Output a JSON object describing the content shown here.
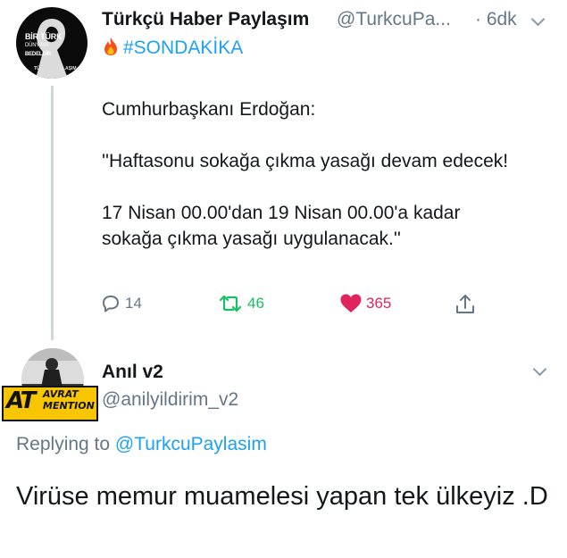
{
  "tweet1": {
    "avatar": {
      "line1": "BİR TÜRK",
      "line2": "DÜNYAYA",
      "line3": "BEDELDİR",
      "sub": "TÜRKÇÜ PAYLAŞIM"
    },
    "name": "Türkçü Haber Paylaşım",
    "handle": "@TurkcuPa...",
    "time": "· 6dk",
    "hashtag_icon": "fire-emoji",
    "hashtag": "#SONDAKİKA",
    "body": "Cumhurbaşkanı Erdoğan:\n\n''Haftasonu sokağa çıkma yasağı devam edecek!\n\n17 Nisan 00.00'dan 19 Nisan 00.00'a kadar sokağa çıkma yasağı uygulanacak.''",
    "actions": {
      "replies": "14",
      "retweets": "46",
      "likes": "365"
    }
  },
  "tweet2": {
    "avatar_badge": {
      "big": "AT",
      "top": "AVRAT",
      "bottom": "MENTION"
    },
    "name": "Anıl v2",
    "handle": "@anilyildirim_v2",
    "replying_prefix": "Replying to",
    "replying_mention": "@TurkcuPaylasim",
    "body": "Virüse memur muamelesi yapan tek ülkeyiz .D"
  },
  "colors": {
    "accent": "#1da1f2",
    "muted": "#657786",
    "retweet": "#17bf63",
    "like": "#e0245e"
  }
}
